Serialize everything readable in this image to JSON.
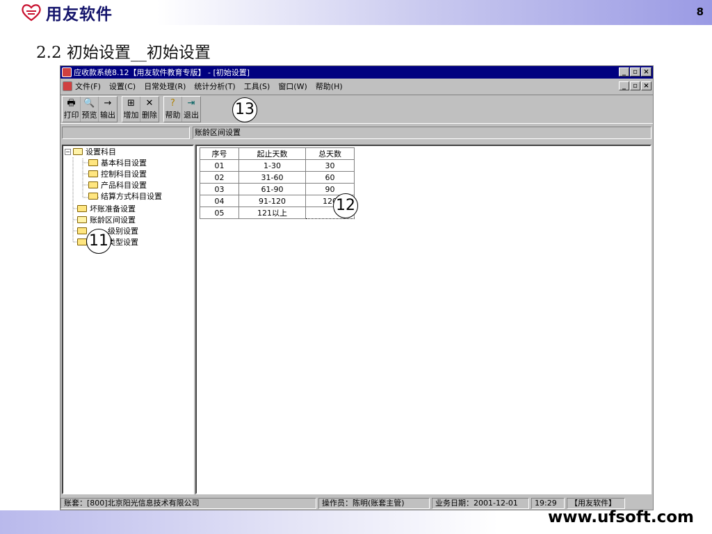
{
  "slide": {
    "brand": "用友软件",
    "page_number": "8",
    "title": "2.2 初始设置__初始设置",
    "footer_url": "www.ufsoft.com"
  },
  "window": {
    "title": "应收款系统8.12【用友软件教育专版】 - [初始设置]",
    "buttons": {
      "minimize": "_",
      "restore": "▫",
      "close": "×"
    }
  },
  "menu": [
    "文件(F)",
    "设置(C)",
    "日常处理(R)",
    "统计分析(T)",
    "工具(S)",
    "窗口(W)",
    "帮助(H)"
  ],
  "toolbar": {
    "groups": [
      [
        {
          "label": "打印",
          "icon": "printer-icon"
        },
        {
          "label": "预览",
          "icon": "preview-icon"
        },
        {
          "label": "输出",
          "icon": "export-icon"
        }
      ],
      [
        {
          "label": "增加",
          "icon": "add-icon"
        },
        {
          "label": "删除",
          "icon": "delete-icon"
        }
      ],
      [
        {
          "label": "帮助",
          "icon": "help-icon"
        },
        {
          "label": "退出",
          "icon": "exit-icon"
        }
      ]
    ]
  },
  "address": {
    "right_label": "账龄区间设置"
  },
  "tree": {
    "root": "设置科目",
    "children": [
      "基本科目设置",
      "控制科目设置",
      "产品科目设置",
      "结算方式科目设置"
    ],
    "siblings": [
      "坏账准备设置",
      "账龄区间设置",
      "级别设置",
      "类型设置"
    ]
  },
  "grid": {
    "headers": [
      "序号",
      "起止天数",
      "总天数"
    ],
    "rows": [
      [
        "01",
        "1-30",
        "30"
      ],
      [
        "02",
        "31-60",
        "60"
      ],
      [
        "03",
        "61-90",
        "90"
      ],
      [
        "04",
        "91-120",
        "120"
      ],
      [
        "05",
        "121以上",
        ""
      ]
    ]
  },
  "status": {
    "account": "账套：[800]北京阳光信息技术有限公司",
    "operator": "操作员：陈明(账套主管)",
    "business_date": "业务日期：2001-12-01",
    "time": "19:29",
    "brand": "【用友软件】"
  },
  "callouts": [
    "11",
    "12",
    "13"
  ]
}
